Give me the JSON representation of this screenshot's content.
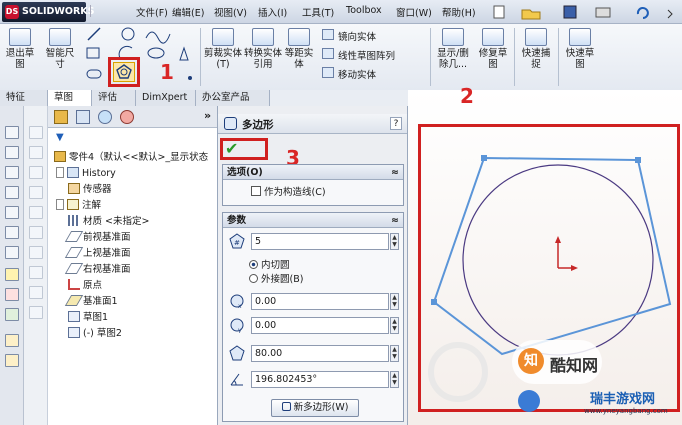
{
  "app": {
    "logo": "SOLIDWORKS",
    "logo_mark": "DS"
  },
  "menu": [
    "文件(F)",
    "编辑(E)",
    "视图(V)",
    "插入(I)",
    "工具(T)",
    "Toolbox",
    "窗口(W)",
    "帮助(H)"
  ],
  "ribbon": {
    "exit_sketch": "退出草图",
    "smart_dim": "智能尺寸",
    "trim": "剪裁实体(T)",
    "convert": "转换实体引用",
    "offset": "等距实体",
    "mirror": "镜向实体",
    "linear_pattern": "线性草图阵列",
    "move": "移动实体",
    "show_delete": "显示/删除几...",
    "repair": "修复草图",
    "quick_snap": "快速捕捉",
    "rapid_sketch": "快速草图"
  },
  "tabs": [
    "特征",
    "草图",
    "评估",
    "DimXpert",
    "办公室产品"
  ],
  "tree": {
    "root": "零件4（默认<<默认>_显示状态",
    "items": [
      "History",
      "传感器",
      "注解",
      "材质 <未指定>",
      "前视基准面",
      "上视基准面",
      "右视基准面",
      "原点",
      "基准面1",
      "草图1",
      "(-) 草图2"
    ]
  },
  "pm": {
    "title": "多边形",
    "help": "?",
    "options_title": "选项(O)",
    "construction_label": "作为构造线(C)",
    "params_title": "参数",
    "sides": "5",
    "inscribed": "内切圆",
    "circumscribed": "外接圆(B)",
    "center_x": "0.00",
    "center_y": "0.00",
    "diameter": "80.00",
    "angle": "196.802453°",
    "new_polygon": "新多边形(W)"
  },
  "annotations": {
    "n1": "1",
    "n2": "2",
    "n3": "3"
  },
  "watermark": {
    "brand": "酷知网",
    "site_name": "瑞丰游戏网",
    "site_url": "www.yneyangbang.com"
  },
  "colors": {
    "highlight": "#d02020",
    "sketch": "#5b95d8",
    "circle": "#4b3a82"
  }
}
